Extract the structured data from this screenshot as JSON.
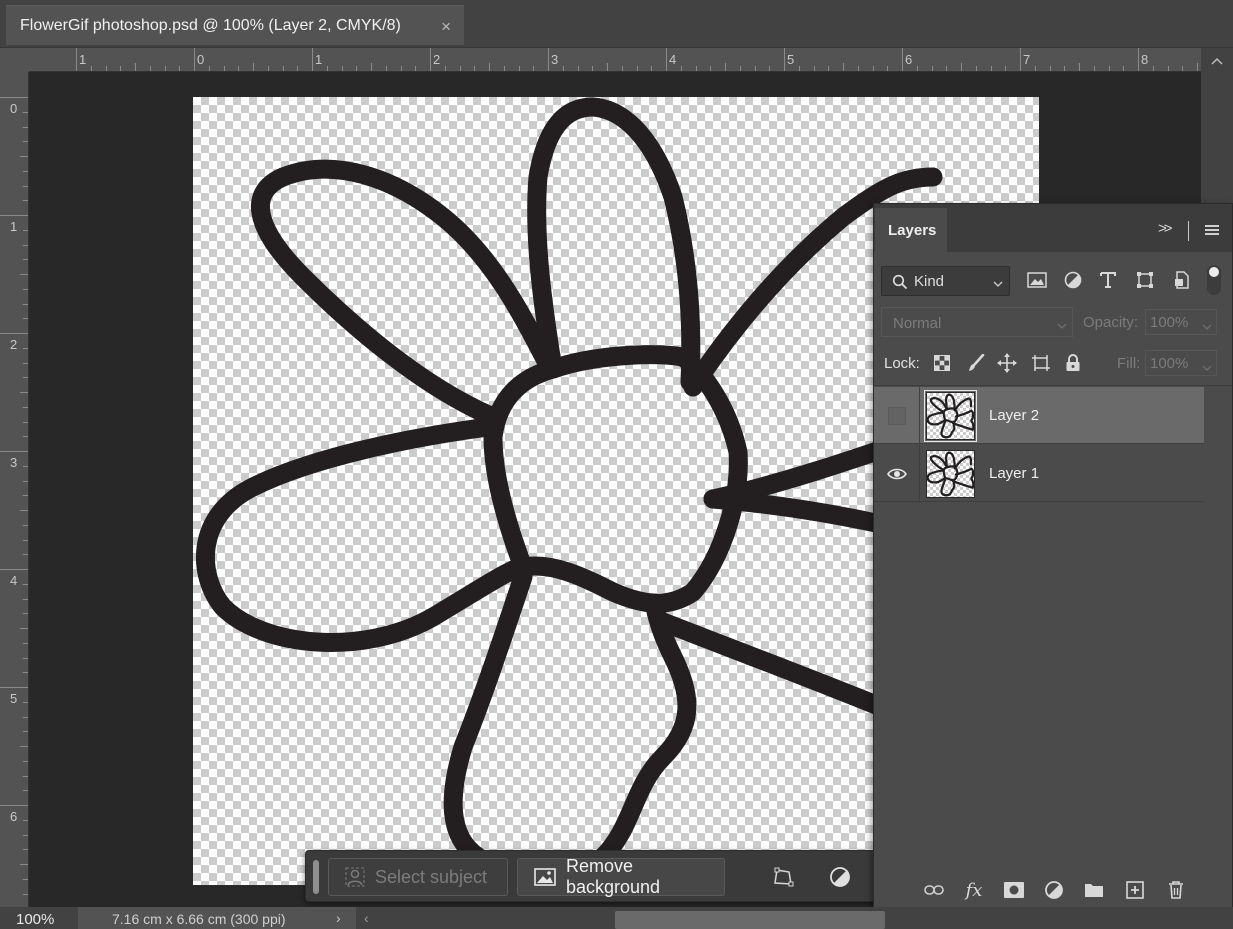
{
  "document": {
    "tab_title": "FlowerGif photoshop.psd @ 100% (Layer 2, CMYK/8)",
    "close_symbol": "×"
  },
  "rulers": {
    "top_labels": [
      "1",
      "0",
      "1",
      "2",
      "3",
      "4",
      "5",
      "6",
      "7",
      "8"
    ],
    "left_labels": [
      "0",
      "1",
      "2",
      "3",
      "4",
      "5",
      "6"
    ]
  },
  "status": {
    "zoom": "100%",
    "doc_info": "7.16 cm x 6.66 cm (300 ppi)",
    "arrow": "›",
    "scroll_left": "‹"
  },
  "taskbar": {
    "select_subject": "Select subject",
    "remove_background": "Remove background",
    "more": "•••"
  },
  "layers_panel": {
    "title": "Layers",
    "collapse": ">>",
    "filter_kind": "Kind",
    "blend_mode": "Normal",
    "opacity_label": "Opacity:",
    "opacity_value": "100%",
    "lock_label": "Lock:",
    "fill_label": "Fill:",
    "fill_value": "100%",
    "layers": [
      {
        "name": "Layer 2",
        "visible": false,
        "selected": true
      },
      {
        "name": "Layer 1",
        "visible": true,
        "selected": false
      }
    ]
  },
  "colors": {
    "ui_dark": "#282828",
    "panel": "#4b4b4b",
    "stroke": "#231f20"
  }
}
